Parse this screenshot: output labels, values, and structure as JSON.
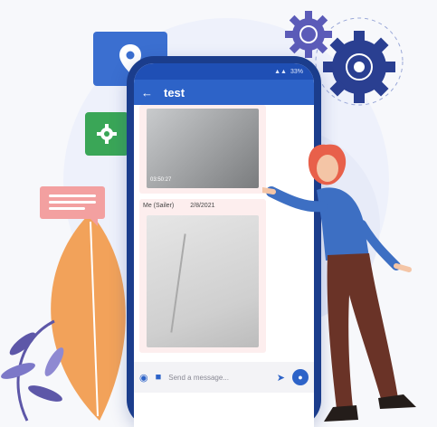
{
  "chat": {
    "title": "test",
    "status_right": "33%",
    "message1": {
      "time": "03:50:27"
    },
    "message2": {
      "sender": "Me (Sailer)",
      "date": "2/8/2021"
    }
  },
  "composer": {
    "placeholder": "Send a message..."
  },
  "floating_card": {
    "lines": 3
  },
  "colors": {
    "phone": "#1b3d8c",
    "appbar": "#2d63c8",
    "accent_orange": "#f2a25a",
    "accent_green": "#3aa657",
    "gear_dark": "#2a3f91",
    "gear_purple": "#5b5bb8"
  },
  "icons": [
    "location-pin-icon",
    "settings-icon",
    "chat-bubble-icon",
    "gear-icon",
    "back-arrow-icon",
    "camera-icon",
    "video-icon",
    "send-icon",
    "mic-icon"
  ]
}
